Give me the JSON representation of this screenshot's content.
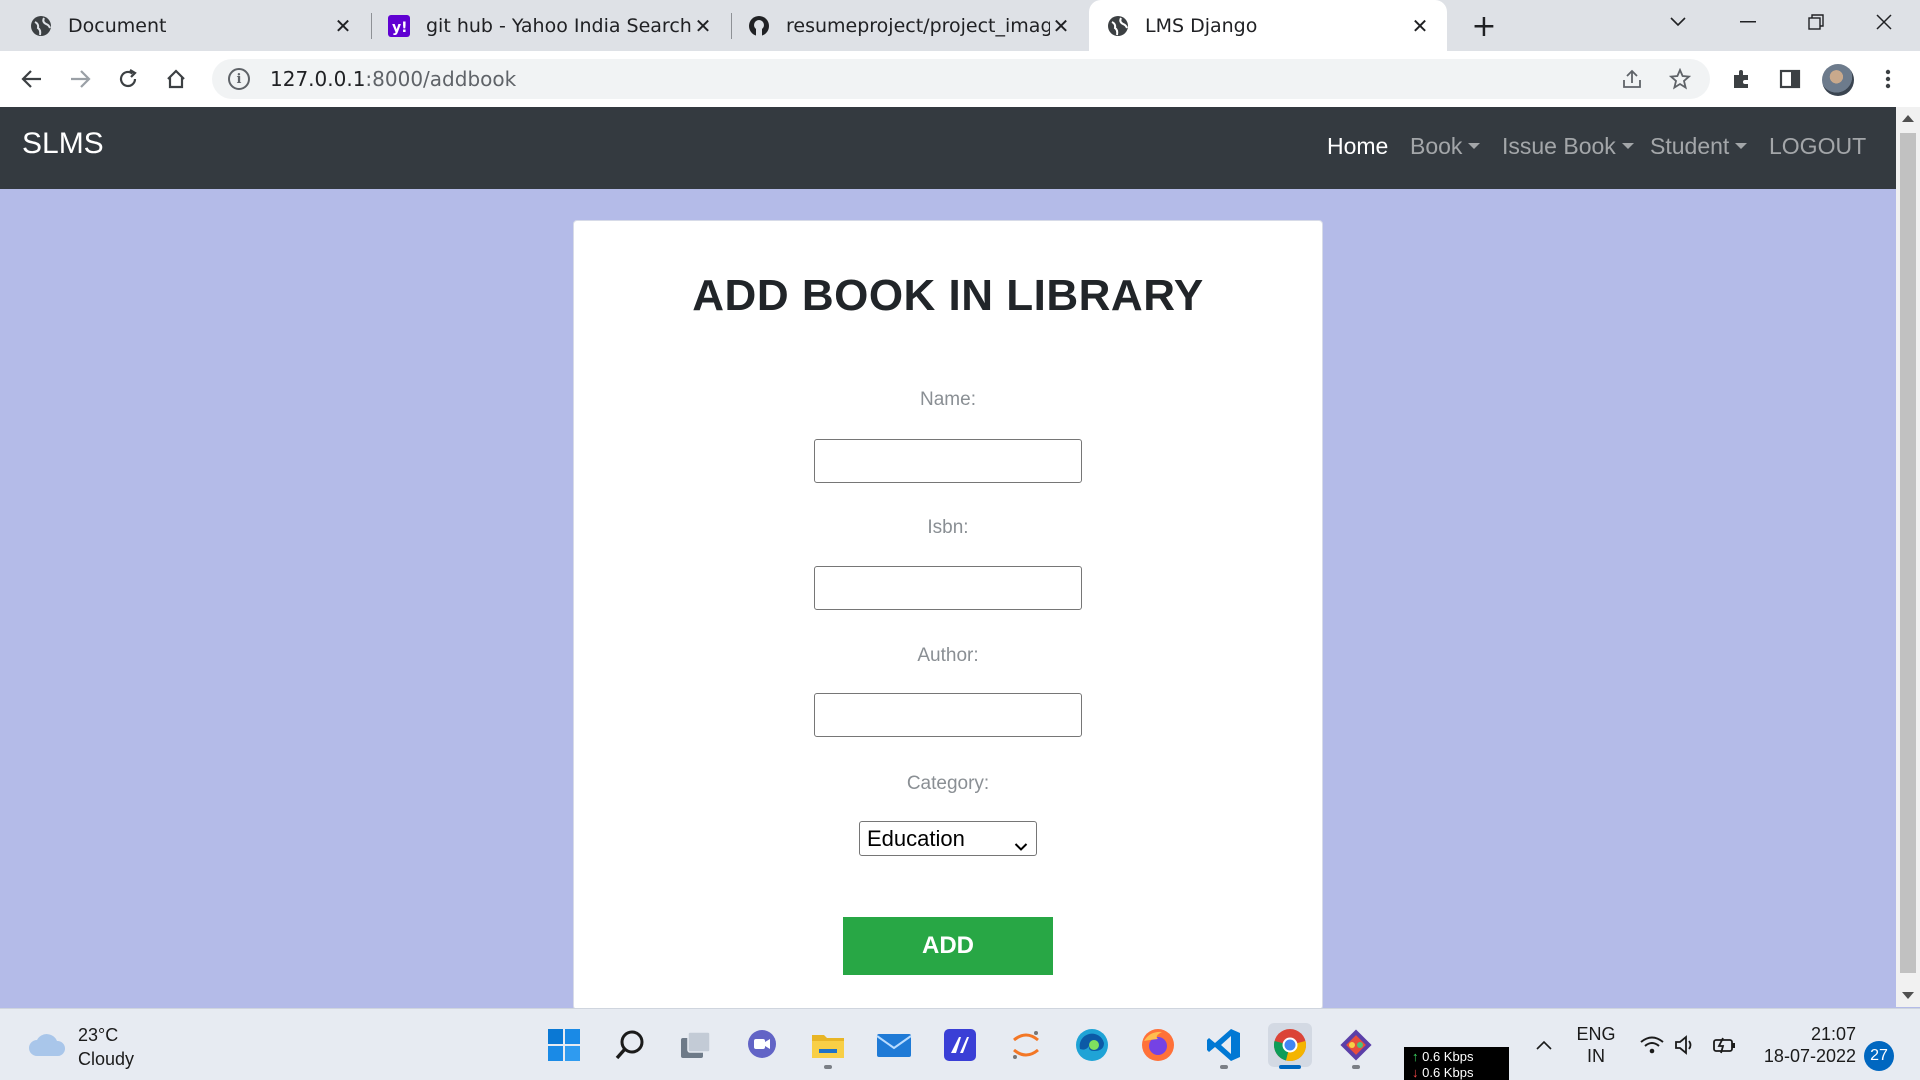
{
  "browser": {
    "tabs": [
      {
        "title": "Document",
        "icon": "globe-icon"
      },
      {
        "title": "git hub - Yahoo India Search Resu",
        "icon": "yahoo-icon"
      },
      {
        "title": "resumeproject/project_image at",
        "icon": "github-icon"
      },
      {
        "title": "LMS Django",
        "icon": "globe-icon",
        "active": true
      }
    ],
    "url_host": "127.0.0.1",
    "url_rest": ":8000/addbook"
  },
  "navbar": {
    "brand": "SLMS",
    "links": [
      "Home",
      "Book",
      "Issue Book",
      "Student",
      "LOGOUT"
    ]
  },
  "form": {
    "title": "ADD BOOK IN LIBRARY",
    "name_label": "Name:",
    "name_value": "",
    "isbn_label": "Isbn:",
    "isbn_value": "",
    "author_label": "Author:",
    "author_value": "",
    "category_label": "Category:",
    "category_selected": "Education",
    "submit_label": "ADD"
  },
  "colors": {
    "page_background": "#b4bbe8",
    "navbar": "#343a40",
    "button": "#28a745"
  },
  "taskbar": {
    "temperature": "23°C",
    "weather": "Cloudy",
    "net_up": "0.6 Kbps",
    "net_down": "0.6 Kbps",
    "lang_1": "ENG",
    "lang_2": "IN",
    "time": "21:07",
    "date": "18-07-2022",
    "notifications": "27"
  }
}
